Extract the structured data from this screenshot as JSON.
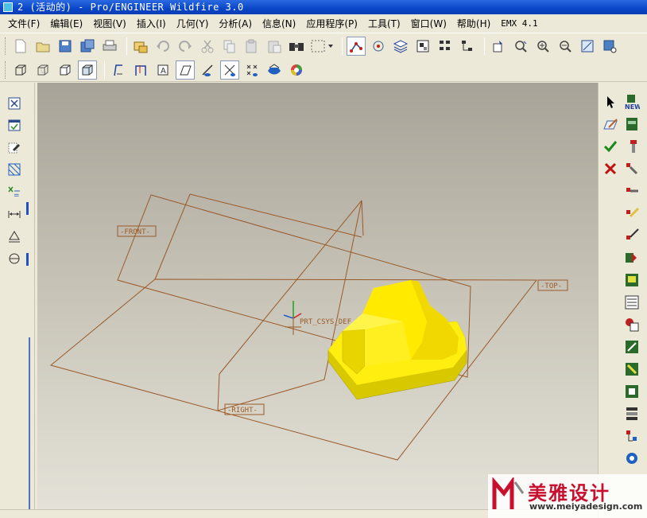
{
  "window": {
    "title": "2 (活动的) - Pro/ENGINEER Wildfire 3.0"
  },
  "menu": [
    "文件(F)",
    "编辑(E)",
    "视图(V)",
    "插入(I)",
    "几何(Y)",
    "分析(A)",
    "信息(N)",
    "应用程序(P)",
    "工具(T)",
    "窗口(W)",
    "帮助(H)",
    "EMX 4.1"
  ],
  "toolbar_row1": [
    "new-file-icon",
    "open-file-icon",
    "save-icon",
    "save-copy-icon",
    "print-icon",
    "regenerate-icon",
    "undo-icon",
    "redo-icon",
    "cut-icon",
    "copy-icon",
    "paste-icon",
    "paste-special-icon",
    "find-icon",
    "select-box-icon",
    "datum-display-icon",
    "spin-center-icon",
    "layers-icon",
    "model-tree-icon",
    "view-manager-icon",
    "selection-filter-icon",
    "repaint-icon",
    "orient-icon",
    "zoom-in-icon",
    "zoom-out-icon",
    "refit-icon",
    "saved-views-icon"
  ],
  "toolbar_row2": [
    "wireframe-icon",
    "hidden-line-icon",
    "no-hidden-icon",
    "shading-icon",
    "datum-plane-icon",
    "datum-axis-icon",
    "datum-point-icon",
    "datum-csys-icon",
    "plane-display-icon",
    "axis-display-icon",
    "point-display-icon",
    "csys-display-icon",
    "appearance-icon",
    "color-wheel-icon"
  ],
  "viewport": {
    "labels": {
      "front": "-FRONT-",
      "top": "-TOP-",
      "right": "-RIGHT-",
      "csys": "PRT_CSYS_DEF"
    },
    "colors": {
      "datum": "#8a4a1a",
      "part": "#ffee00",
      "part_shade": "#d8c400",
      "bg_top": "#a7a398",
      "bg_bottom": "#e4e2d8"
    }
  },
  "watermark": {
    "title": "美雅设计",
    "url": "www.meiyadesign.com"
  }
}
